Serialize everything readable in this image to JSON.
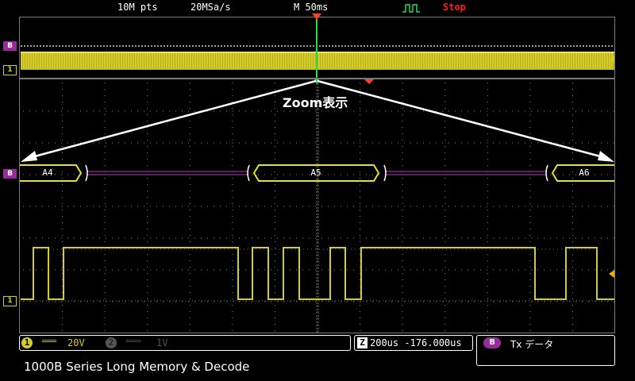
{
  "top_bar": {
    "points": "10M pts",
    "sample_rate": "20MSa/s",
    "timebase": "M 50ms",
    "run_state": "Stop"
  },
  "overview": {
    "bus_marker": "B",
    "ch1_marker": "1"
  },
  "annotation": {
    "zoom_label": "Zoom表示"
  },
  "decode": {
    "bus_marker": "B",
    "frames": [
      "A4",
      "A5",
      "A6"
    ]
  },
  "signal": {
    "ch1_marker": "1"
  },
  "status_bar": {
    "ch1_num": "1",
    "ch1_coupling": "═══",
    "ch1_scale": "20V",
    "ch2_num": "2",
    "ch2_coupling": "═══",
    "ch2_scale": "1V",
    "zoom_badge": "Z",
    "zoom_readout": "200us -176.000us",
    "bus_badge": "B",
    "bus_info": "Tx データ"
  },
  "caption": "1000B Series Long Memory & Decode",
  "colors": {
    "ch1": "#d4cc2a",
    "bus": "#9a2a9a",
    "stop": "#ff2020",
    "marker": "#ff4020",
    "grid": "#8a8a8a"
  }
}
